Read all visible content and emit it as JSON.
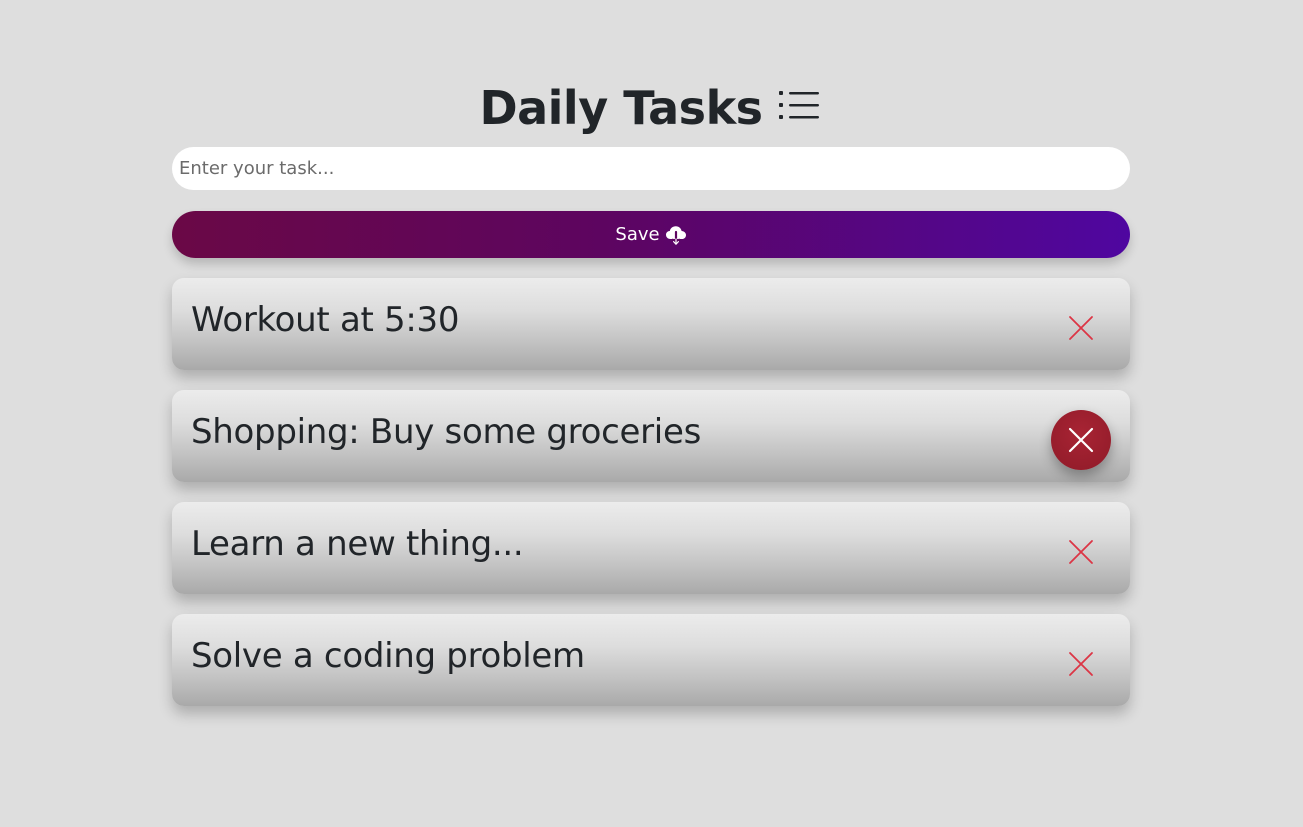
{
  "header": {
    "title": "Daily Tasks",
    "title_icon": "list-icon"
  },
  "input": {
    "placeholder": "Enter your task...",
    "value": ""
  },
  "save_button": {
    "label": "Save",
    "icon": "cloud-download-icon",
    "gradient": [
      "#6a0846",
      "#4f06a0"
    ]
  },
  "tasks": [
    {
      "text": "Workout at 5:30",
      "hovered": false
    },
    {
      "text": "Shopping: Buy some groceries",
      "hovered": true
    },
    {
      "text": "Learn a new thing...",
      "hovered": false
    },
    {
      "text": "Solve a coding problem",
      "hovered": false
    }
  ],
  "colors": {
    "background": "#dedede",
    "delete_icon": "#dc3545",
    "delete_hover_bg": "#9b1f2e"
  }
}
